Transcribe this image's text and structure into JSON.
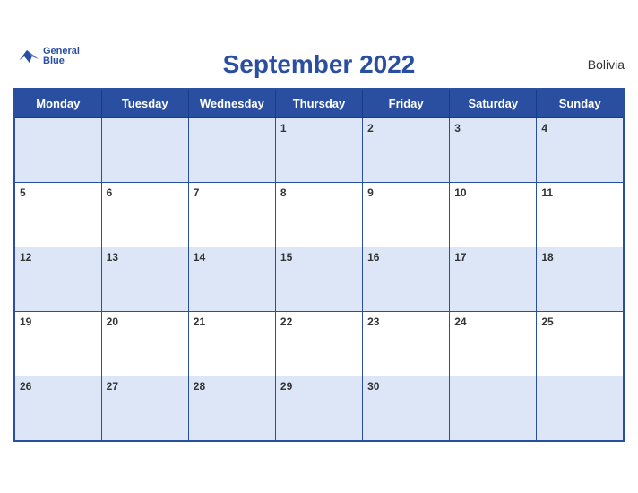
{
  "header": {
    "title": "September 2022",
    "country": "Bolivia",
    "logo": {
      "general": "General",
      "blue": "Blue"
    }
  },
  "weekdays": [
    "Monday",
    "Tuesday",
    "Wednesday",
    "Thursday",
    "Friday",
    "Saturday",
    "Sunday"
  ],
  "weeks": [
    [
      {
        "day": "",
        "empty": true
      },
      {
        "day": "",
        "empty": true
      },
      {
        "day": "",
        "empty": true
      },
      {
        "day": "1"
      },
      {
        "day": "2"
      },
      {
        "day": "3"
      },
      {
        "day": "4"
      }
    ],
    [
      {
        "day": "5"
      },
      {
        "day": "6"
      },
      {
        "day": "7"
      },
      {
        "day": "8"
      },
      {
        "day": "9"
      },
      {
        "day": "10"
      },
      {
        "day": "11"
      }
    ],
    [
      {
        "day": "12"
      },
      {
        "day": "13"
      },
      {
        "day": "14"
      },
      {
        "day": "15"
      },
      {
        "day": "16"
      },
      {
        "day": "17"
      },
      {
        "day": "18"
      }
    ],
    [
      {
        "day": "19"
      },
      {
        "day": "20"
      },
      {
        "day": "21"
      },
      {
        "day": "22"
      },
      {
        "day": "23"
      },
      {
        "day": "24"
      },
      {
        "day": "25"
      }
    ],
    [
      {
        "day": "26"
      },
      {
        "day": "27"
      },
      {
        "day": "28"
      },
      {
        "day": "29"
      },
      {
        "day": "30"
      },
      {
        "day": "",
        "empty": true
      },
      {
        "day": "",
        "empty": true
      }
    ]
  ]
}
